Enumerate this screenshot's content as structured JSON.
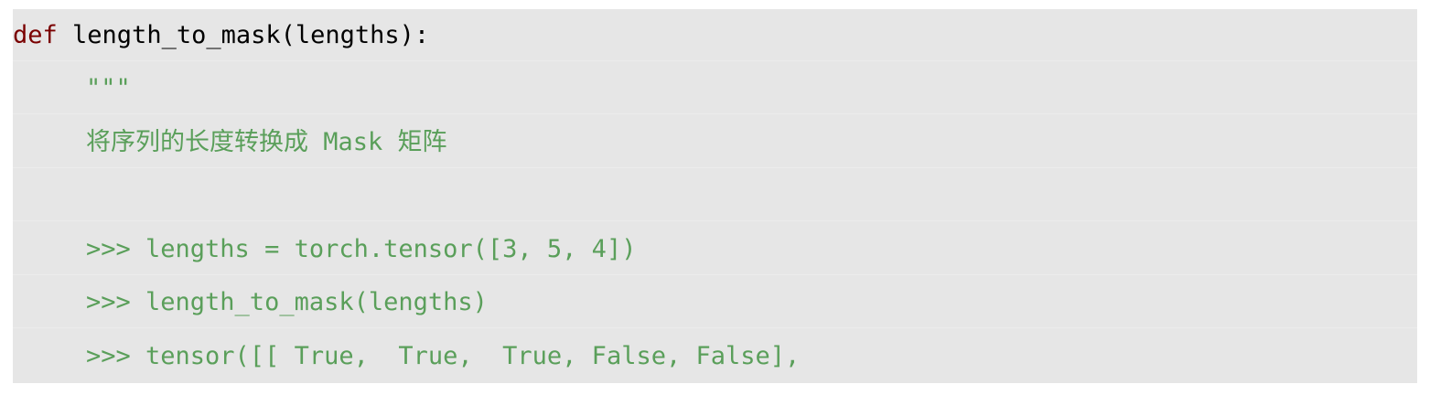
{
  "code": {
    "line1_keyword": "def",
    "line1_signature": " length_to_mask(lengths):",
    "line2_docstring_open": "\"\"\"",
    "line3_description": "将序列的长度转换成 Mask 矩阵",
    "line4_blank": "",
    "line5_example": ">>> lengths = torch.tensor([3, 5, 4])",
    "line6_example": ">>> length_to_mask(lengths)",
    "line7_example": ">>> tensor([[ True,  True,  True, False, False],"
  },
  "colors": {
    "background": "#e6e6e6",
    "keyword": "#7a0000",
    "docstring": "#5a9f5a",
    "text": "#000000"
  }
}
